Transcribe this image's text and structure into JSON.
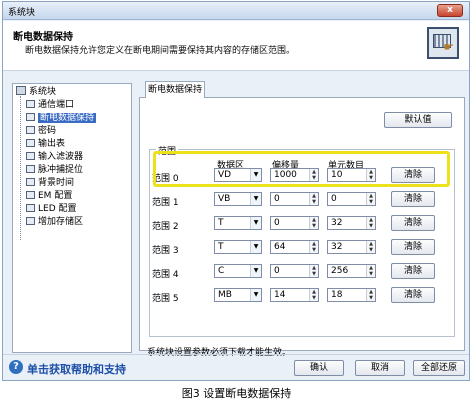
{
  "window": {
    "title": "系统块",
    "close_glyph": "x"
  },
  "header": {
    "title": "断电数据保持",
    "description": "断电数据保持允许您定义在断电期间需要保持其内容的存储区范围。",
    "icon": "retentive-memory-icon"
  },
  "tree": {
    "root": "系统块",
    "items": [
      "通信端口",
      "断电数据保持",
      "密码",
      "输出表",
      "输入滤波器",
      "脉冲捕捉位",
      "背景时间",
      "EM 配置",
      "LED 配置",
      "增加存储区"
    ],
    "selected_index": 1
  },
  "tab": {
    "label": "断电数据保持"
  },
  "defaults_button": "默认值",
  "ranges": {
    "group_label": "范围",
    "headers": {
      "area": "数据区",
      "offset": "偏移量",
      "count": "单元数目"
    },
    "rows": [
      {
        "label": "范围 0",
        "area": "VD",
        "offset": "1000",
        "count": "10",
        "clear": "清除"
      },
      {
        "label": "范围 1",
        "area": "VB",
        "offset": "0",
        "count": "0",
        "clear": "清除"
      },
      {
        "label": "范围 2",
        "area": "T",
        "offset": "0",
        "count": "32",
        "clear": "清除"
      },
      {
        "label": "范围 3",
        "area": "T",
        "offset": "64",
        "count": "32",
        "clear": "清除"
      },
      {
        "label": "范围 4",
        "area": "C",
        "offset": "0",
        "count": "256",
        "clear": "清除"
      },
      {
        "label": "范围 5",
        "area": "MB",
        "offset": "14",
        "count": "18",
        "clear": "清除"
      }
    ]
  },
  "note": "系统块设置参数必须下载才能生效。",
  "footer": {
    "help_text": "单击获取帮助和支持",
    "ok": "确认",
    "cancel": "取消",
    "restore_all": "全部还原"
  },
  "caption": "图3 设置断电数据保持",
  "colors": {
    "highlight": "#ede11c",
    "selected": "#3b6cc3",
    "help_link": "#1e4fa8"
  }
}
